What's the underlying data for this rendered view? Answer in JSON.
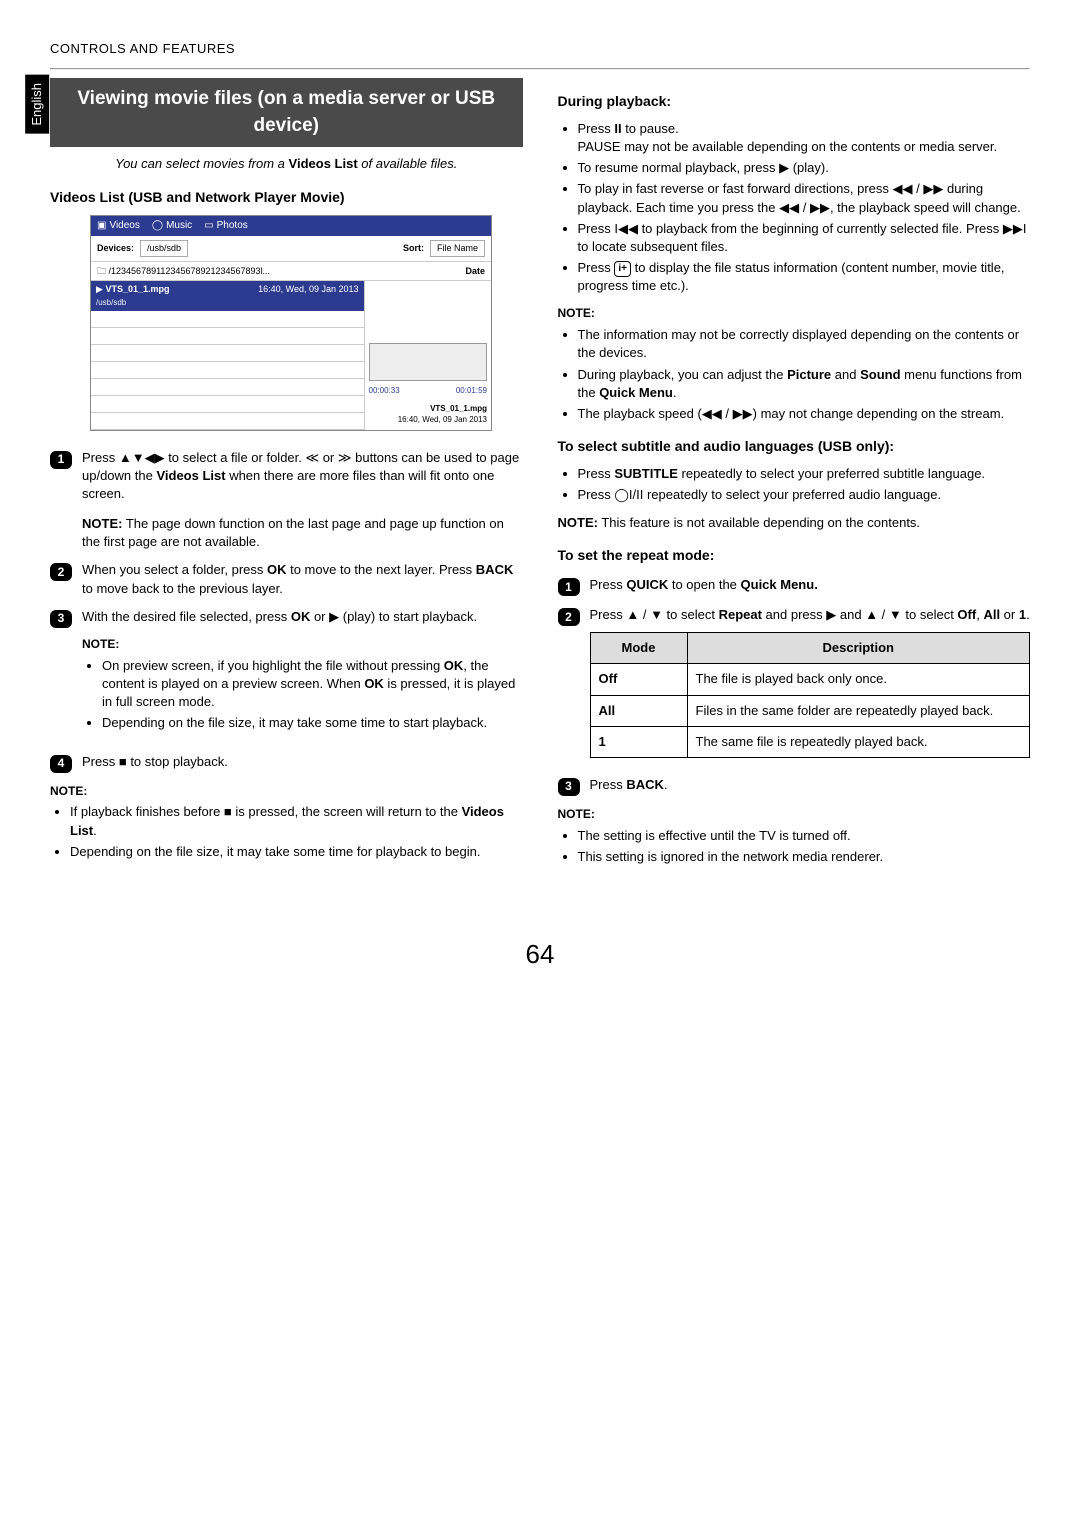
{
  "header": "CONTROLS AND FEATURES",
  "language_tab": "English",
  "page_number": "64",
  "left": {
    "title": "Viewing movie files (on a media server or USB device)",
    "intro_pre": "You can select movies from a ",
    "intro_bold": "Videos List",
    "intro_post": " of available files.",
    "list_heading": "Videos List (USB and Network Player Movie)",
    "ui": {
      "tabs": {
        "videos": "Videos",
        "music": "Music",
        "photos": "Photos"
      },
      "devices_label": "Devices:",
      "devices_value": "/usb/sdb",
      "sort_label": "Sort:",
      "sort_value": "File Name",
      "path": "/123456789112345678921234567893l...",
      "path_right": "Date",
      "selected_file": "VTS_01_1.mpg",
      "selected_subtext": "/usb/sdb",
      "selected_date": "16:40, Wed, 09 Jan 2013",
      "time_current": "00:00:33",
      "time_total": "00:01:59",
      "preview_file": "VTS_01_1.mpg",
      "preview_date": "16:40, Wed, 09 Jan 2013"
    },
    "step1_a": "Press ",
    "step1_b": " to select a file or folder. ",
    "step1_c": " or ",
    "step1_d": " buttons can be used to page up/down the ",
    "step1_bold1": "Videos List",
    "step1_e": " when there are more files than will fit onto one screen.",
    "step1_note_label": "NOTE:",
    "step1_note": " The page down function on the last page and page up function on the first page are not available.",
    "step2_a": "When you select a folder, press ",
    "step2_ok": "OK",
    "step2_b": " to move to the next layer. Press ",
    "step2_back": "BACK",
    "step2_c": " to move back to the previous layer.",
    "step3_a": "With the desired file selected, press ",
    "step3_ok": "OK",
    "step3_b": " or ",
    "step3_c": " (play) to start playback.",
    "step3_note_label": "NOTE:",
    "step3_bul1_a": "On preview screen, if you highlight the file without pressing ",
    "step3_bul1_ok": "OK",
    "step3_bul1_b": ", the content is played on a preview screen. When ",
    "step3_bul1_ok2": "OK",
    "step3_bul1_c": " is pressed, it is played in full screen mode.",
    "step3_bul2": "Depending on the file size, it may take some time to start playback.",
    "step4_a": "Press ",
    "step4_b": " to stop playback.",
    "bottom_note_label": "NOTE:",
    "bottom_bul1_a": "If playback finishes before ",
    "bottom_bul1_b": " is pressed, the screen will return to the ",
    "bottom_bul1_bold": "Videos List",
    "bottom_bul1_c": ".",
    "bottom_bul2": "Depending on the file size, it may take some time for playback to begin."
  },
  "right": {
    "heading1": "During playback:",
    "b1_a": "Press ",
    "b1_b": " to pause.",
    "b1_extra": "PAUSE may not be available depending on the contents or media server.",
    "b2_a": "To resume normal playback, press ",
    "b2_b": " (play).",
    "b3_a": "To play in fast reverse or fast forward directions, press ",
    "b3_b": " / ",
    "b3_c": " during playback. Each time you press the ",
    "b3_d": " / ",
    "b3_e": ", the playback speed will change.",
    "b4_a": "Press ",
    "b4_b": " to playback from the beginning of currently selected file. Press ",
    "b4_c": " to locate subsequent files.",
    "b5_a": "Press ",
    "b5_b": " to display the file status information (content number, movie title, progress time etc.).",
    "note1_label": "NOTE:",
    "note1_bul1": "The information may not be correctly displayed depending on the contents or the devices.",
    "note1_bul2_a": "During playback, you can adjust the ",
    "note1_bul2_pic": "Picture",
    "note1_bul2_b": " and ",
    "note1_bul2_sound": "Sound",
    "note1_bul2_c": " menu functions from the ",
    "note1_bul2_qm": "Quick Menu",
    "note1_bul2_d": ".",
    "note1_bul3_a": "The playback speed (",
    "note1_bul3_b": " / ",
    "note1_bul3_c": ") may not change depending on the stream.",
    "heading2": "To select subtitle and audio languages (USB only):",
    "sub_bul1_a": "Press ",
    "sub_bul1_bold": "SUBTITLE",
    "sub_bul1_b": " repeatedly to select your preferred subtitle language.",
    "sub_bul2_a": "Press ",
    "sub_bul2_b": " repeatedly to select your preferred audio language.",
    "sub_note_label": "NOTE:",
    "sub_note": " This feature is not available depending on the contents.",
    "heading3": "To set the repeat mode:",
    "rstep1_a": "Press ",
    "rstep1_quick": "QUICK",
    "rstep1_b": " to open the ",
    "rstep1_qm": "Quick Menu.",
    "rstep2_a": "Press ",
    "rstep2_b": " / ",
    "rstep2_c": " to select ",
    "rstep2_rep": "Repeat",
    "rstep2_d": " and press ",
    "rstep2_e": " and ",
    "rstep2_f": " / ",
    "rstep2_g": " to select ",
    "rstep2_off": "Off",
    "rstep2_h": ", ",
    "rstep2_all": "All",
    "rstep2_i": " or ",
    "rstep2_one": "1",
    "rstep2_j": ".",
    "table": {
      "h_mode": "Mode",
      "h_desc": "Description",
      "r1m": "Off",
      "r1d": "The file is played back only once.",
      "r2m": "All",
      "r2d": "Files in the same folder are repeatedly played back.",
      "r3m": "1",
      "r3d": "The same file is repeatedly played back."
    },
    "rstep3_a": "Press ",
    "rstep3_back": "BACK",
    "rstep3_b": ".",
    "final_note_label": "NOTE:",
    "final_bul1": "The setting is effective until the TV is turned off.",
    "final_bul2": "This setting is ignored in the network media renderer."
  }
}
